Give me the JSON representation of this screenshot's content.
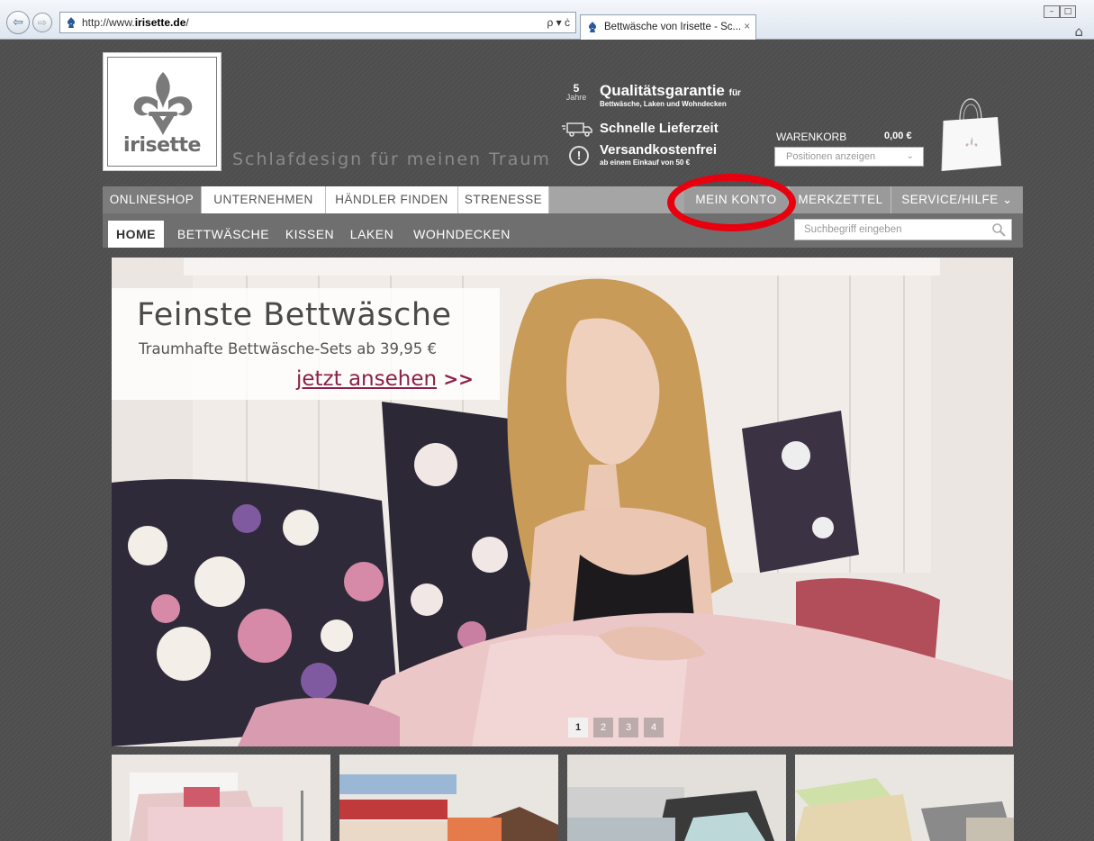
{
  "browser": {
    "url_prefix": "http://www.",
    "url_domain": "irisette.de",
    "url_suffix": "/",
    "address_tools": "ρ ▾ ċ",
    "tab_title": "Bettwäsche von Irisette - Sc...",
    "tab_close": "×",
    "back_icon": "⇦",
    "forward_icon": "⇨",
    "home_icon": "⌂",
    "win_min": "–",
    "win_max": "□"
  },
  "header": {
    "logo_text": "irisette",
    "slogan": "Schlafdesign für meinen Traum",
    "usp": [
      {
        "badge_num": "5",
        "badge_unit": "Jahre",
        "title": "Qualitätsgarantie",
        "title_suffix": "für",
        "sub": "Bettwäsche, Laken und Wohndecken"
      },
      {
        "title": "Schnelle Lieferzeit"
      },
      {
        "title": "Versandkostenfrei",
        "sub": "ab einem Einkauf von 50 €",
        "icon": "!"
      }
    ],
    "cart": {
      "label": "WARENKORB",
      "sum": "0,00 €",
      "select": "Positionen anzeigen",
      "chevron": "⌄"
    }
  },
  "mainnav": {
    "items": [
      "ONLINESHOP",
      "UNTERNEHMEN",
      "HÄNDLER FINDEN",
      "STRENESSE"
    ],
    "right": [
      "MEIN KONTO",
      "MERKZETTEL",
      "SERVICE/HILFE ⌄"
    ]
  },
  "subnav": {
    "items": [
      "HOME",
      "BETTWÄSCHE",
      "KISSEN",
      "LAKEN",
      "WOHNDECKEN"
    ],
    "search_placeholder": "Suchbegriff eingeben"
  },
  "hero": {
    "title": "Feinste Bettwäsche",
    "subtitle": "Traumhafte Bettwäsche-Sets ab 39,95 €",
    "cta": "jetzt ansehen",
    "cta_arrows": ">>",
    "slides": [
      "1",
      "2",
      "3",
      "4"
    ],
    "active_slide": "1"
  },
  "colors": {
    "accent": "#8b2048",
    "annotation": "#e8000f",
    "nav_gray": "#a5a5a5"
  }
}
